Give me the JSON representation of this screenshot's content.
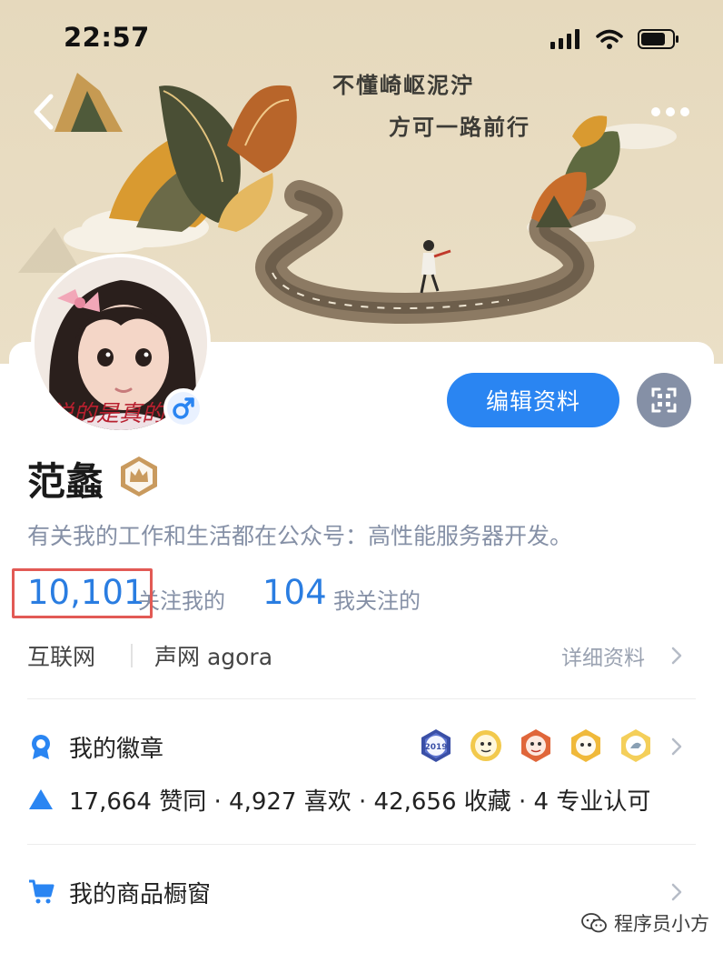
{
  "status_bar": {
    "time": "22:57"
  },
  "cover": {
    "poem_line1": "不懂崎岖泥泞",
    "poem_line2": "方可一路前行"
  },
  "avatar": {
    "overlay_text": "说的是真的"
  },
  "profile": {
    "name": "范蠡",
    "bio": "有关我的工作和生活都在公众号：高性能服务器开发。",
    "edit_button": "编辑资料"
  },
  "stats": {
    "followers_count": "10,101",
    "followers_label": "关注我的",
    "following_count": "104",
    "following_label": "我关注的"
  },
  "info": {
    "industry": "互联网",
    "company": "声网 agora",
    "detail_link": "详细资料"
  },
  "badges": {
    "label": "我的徽章",
    "year_badge_text": "2019"
  },
  "achievements": {
    "text": "17,664 赞同 · 4,927 喜欢 · 42,656 收藏 · 4 专业认可"
  },
  "shop": {
    "label": "我的商品橱窗"
  },
  "watermark": {
    "text": "程序员小方"
  },
  "colors": {
    "accent": "#2a85f2",
    "stat_blue": "#2a7de1",
    "highlight_red": "#e25a55",
    "muted": "#8590a6"
  }
}
